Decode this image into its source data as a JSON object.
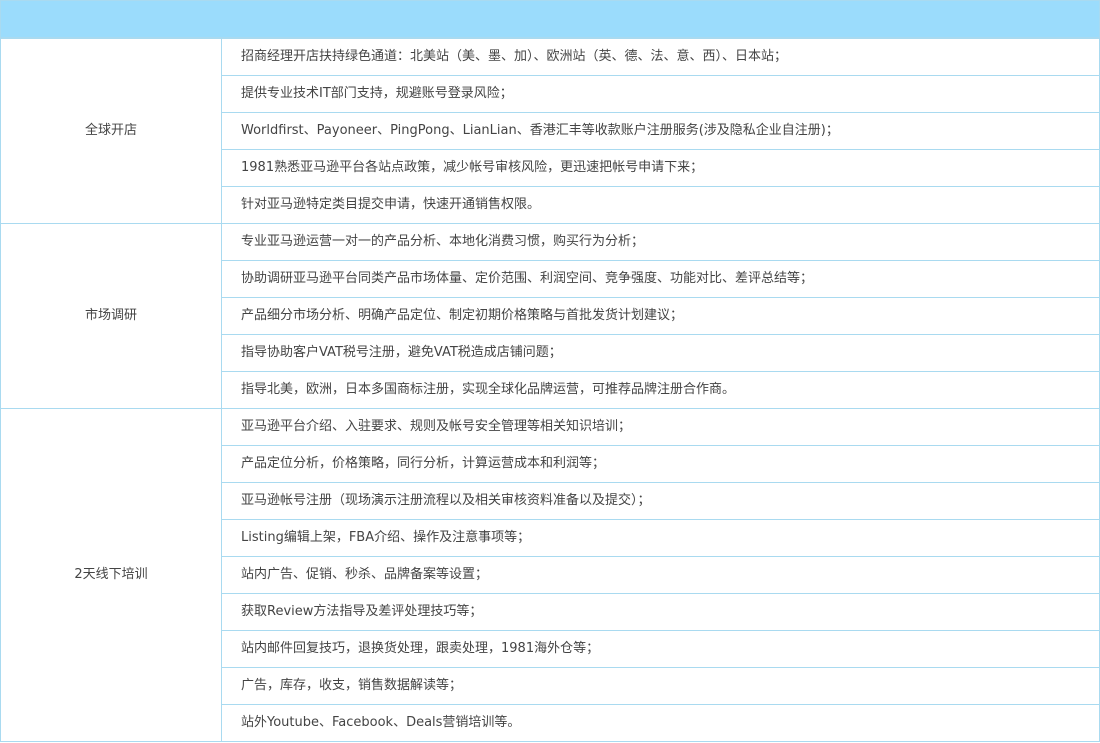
{
  "sections": [
    {
      "category": "全球开店",
      "items": [
        "招商经理开店扶持绿色通道：北美站（美、墨、加）、欧洲站（英、德、法、意、西）、日本站；",
        "提供专业技术IT部门支持，规避账号登录风险；",
        "Worldfirst、Payoneer、PingPong、LianLian、香港汇丰等收款账户注册服务(涉及隐私企业自注册)；",
        "1981熟悉亚马逊平台各站点政策，减少帐号审核风险，更迅速把帐号申请下来；",
        "针对亚马逊特定类目提交申请，快速开通销售权限。"
      ]
    },
    {
      "category": "市场调研",
      "items": [
        "专业亚马逊运营一对一的产品分析、本地化消费习惯，购买行为分析；",
        "协助调研亚马逊平台同类产品市场体量、定价范围、利润空间、竞争强度、功能对比、差评总结等；",
        "产品细分市场分析、明确产品定位、制定初期价格策略与首批发货计划建议；",
        "指导协助客户VAT税号注册，避免VAT税造成店铺问题；",
        "指导北美，欧洲，日本多国商标注册，实现全球化品牌运营，可推荐品牌注册合作商。"
      ]
    },
    {
      "category": "2天线下培训",
      "items": [
        "亚马逊平台介绍、入驻要求、规则及帐号安全管理等相关知识培训；",
        "产品定位分析，价格策略，同行分析，计算运营成本和利润等；",
        "亚马逊帐号注册（现场演示注册流程以及相关审核资料准备以及提交）；",
        "Listing编辑上架，FBA介绍、操作及注意事项等；",
        "站内广告、促销、秒杀、品牌备案等设置；",
        "获取Review方法指导及差评处理技巧等；",
        "站内邮件回复技巧，退换货处理，跟卖处理，1981海外仓等；",
        "广告，库存，收支，销售数据解读等；",
        "站外Youtube、Facebook、Deals营销培训等。"
      ]
    }
  ]
}
